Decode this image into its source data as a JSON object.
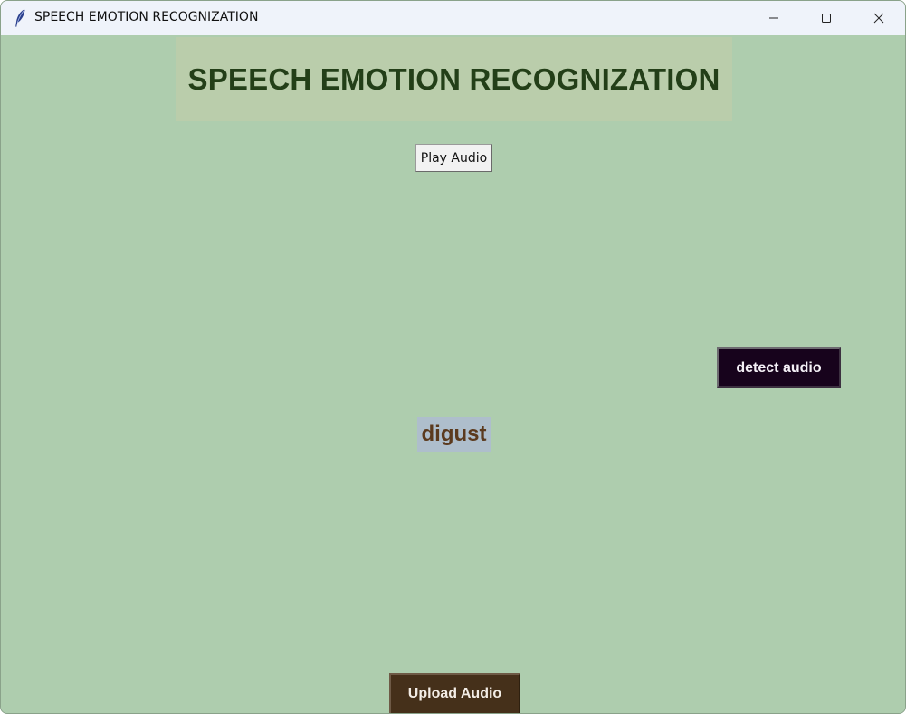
{
  "window": {
    "title": "SPEECH EMOTION RECOGNIZATION"
  },
  "window_controls": {
    "minimize_icon": "minimize-icon",
    "maximize_icon": "maximize-icon",
    "close_icon": "close-icon"
  },
  "main": {
    "heading": "SPEECH EMOTION RECOGNIZATION",
    "play_button": "Play Audio",
    "detect_button": "detect audio",
    "result_label": "digust",
    "upload_button": "Upload Audio"
  },
  "colors": {
    "background": "#aecdae",
    "heading_bg": "#bacdab",
    "heading_text": "#233f18",
    "detect_button_bg": "#17031c",
    "result_bg": "#aebecc",
    "result_text": "#5b3a1e",
    "upload_button_bg": "#45301a"
  }
}
